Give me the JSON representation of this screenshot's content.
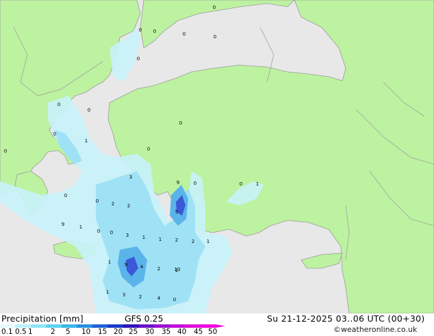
{
  "footer": {
    "title": "Precipitation [mm]",
    "model": "GFS 0.25",
    "valid_time": "Su 21-12-2025 03..06 UTC (00+30)",
    "credit": "©weatheronline.co.uk"
  },
  "legend": {
    "ticks": [
      "0.1",
      "0.5",
      "1",
      "2",
      "5",
      "10",
      "15",
      "20",
      "25",
      "30",
      "35",
      "40",
      "45",
      "50"
    ],
    "colors": [
      "#e6fbff",
      "#b9f1fb",
      "#8ee4f7",
      "#5cd2f2",
      "#3ab8e8",
      "#2a8ee0",
      "#2060d8",
      "#1a3ac8",
      "#3010b8",
      "#6a10c8",
      "#9a10d0",
      "#c010d8",
      "#e010d8",
      "#f000e0"
    ]
  },
  "colors": {
    "land": "#bdf2a0",
    "sea": "#e8e8e8",
    "border": "#a0a0a0",
    "precip_light": "#c8f2fb",
    "precip_mid": "#9fe2f5",
    "precip_heavy": "#5ab4ea",
    "precip_core": "#3a58d8"
  },
  "map": {
    "value_labels": [
      "0",
      "0",
      "0",
      "0",
      "0",
      "0",
      "0",
      "0",
      "1",
      "0",
      "0",
      "0",
      "3",
      "0",
      "9",
      "0",
      "0",
      "0",
      "0",
      "1",
      "2",
      "2",
      "9",
      "0",
      "1",
      "0",
      "1",
      "3",
      "1",
      "2",
      "5",
      "2",
      "1",
      "10",
      "1",
      "9",
      "4",
      "2",
      "1",
      "1",
      "3",
      "2",
      "4",
      "0"
    ]
  }
}
